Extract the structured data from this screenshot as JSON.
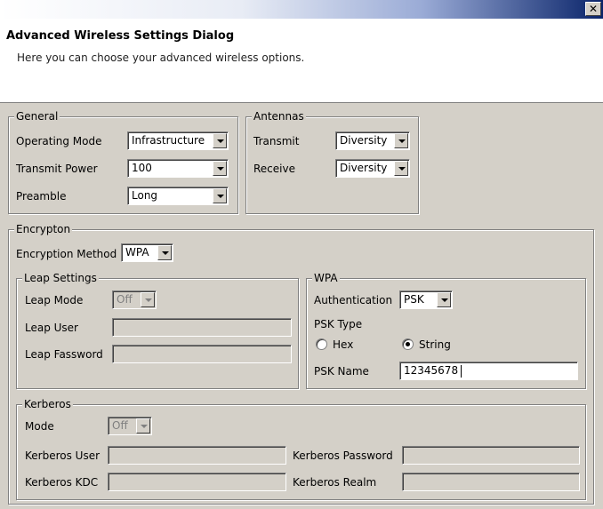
{
  "window": {
    "close_glyph": "✕"
  },
  "header": {
    "title": "Advanced Wireless Settings Dialog",
    "subtitle": "Here you can choose your advanced wireless options."
  },
  "general": {
    "legend": "General",
    "operating_mode": {
      "label": "Operating Mode",
      "value": "Infrastructure"
    },
    "transmit_power": {
      "label": "Transmit Power",
      "value": "100"
    },
    "preamble": {
      "label": "Preamble",
      "value": "Long"
    }
  },
  "antennas": {
    "legend": "Antennas",
    "transmit": {
      "label": "Transmit",
      "value": "Diversity"
    },
    "receive": {
      "label": "Receive",
      "value": "Diversity"
    }
  },
  "encryption": {
    "legend": "Encrypton",
    "method": {
      "label": "Encryption Method",
      "value": "WPA"
    },
    "leap": {
      "legend": "Leap Settings",
      "mode": {
        "label": "Leap Mode",
        "value": "Off"
      },
      "user": {
        "label": "Leap User",
        "value": ""
      },
      "password": {
        "label": "Leap Fassword",
        "value": ""
      }
    },
    "wpa": {
      "legend": "WPA",
      "authentication": {
        "label": "Authentication",
        "value": "PSK"
      },
      "psk_type": {
        "label": "PSK Type",
        "hex_label": "Hex",
        "string_label": "String",
        "selected": "String"
      },
      "psk_name": {
        "label": "PSK Name",
        "value": "12345678"
      }
    },
    "kerberos": {
      "legend": "Kerberos",
      "mode": {
        "label": "Mode",
        "value": "Off"
      },
      "user": {
        "label": "Kerberos User",
        "value": ""
      },
      "password": {
        "label": "Kerberos Password",
        "value": ""
      },
      "kdc": {
        "label": "Kerberos KDC",
        "value": ""
      },
      "realm": {
        "label": "Kerberos Realm",
        "value": ""
      }
    }
  }
}
